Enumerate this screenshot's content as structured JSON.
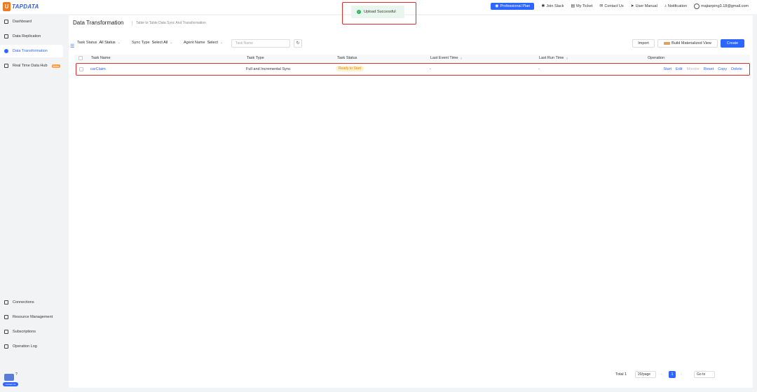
{
  "app": {
    "logo_letter": "U",
    "logo_text": "TAPDATA"
  },
  "topnav": {
    "pro_plan": "Professional Plan",
    "join_slack": "Join Slack",
    "my_ticket": "My Ticket",
    "contact_us": "Contact Us",
    "user_manual": "User Manual",
    "notification": "Notification",
    "user_email": "majianping3.18@gmail.com"
  },
  "sidebar": {
    "items": [
      {
        "label": "Dashboard",
        "icon": "dashboard-icon"
      },
      {
        "label": "Data Replication",
        "icon": "database-icon"
      },
      {
        "label": "Data Transformation",
        "icon": "transformation-icon",
        "active": true
      },
      {
        "label": "Real Time Data Hub",
        "icon": "datahub-icon",
        "badge": "Beta"
      }
    ],
    "bottom_items": [
      {
        "label": "Connections",
        "icon": "connections-icon"
      },
      {
        "label": "Resource Management",
        "icon": "resource-icon"
      },
      {
        "label": "Subscriptions",
        "icon": "subscriptions-icon"
      },
      {
        "label": "Operation Log",
        "icon": "log-icon"
      }
    ],
    "chat_label": "Contact Us",
    "chat_q": "?"
  },
  "page": {
    "title": "Data Transformation",
    "subtitle": "Table to Table Data Sync And Transformation"
  },
  "filters": {
    "task_status_label": "Task Status",
    "task_status_value": "All Status",
    "sync_type_label": "Sync Type",
    "sync_type_value": "Select All",
    "agent_name_label": "Agent Name",
    "agent_name_value": "Select",
    "search_placeholder": "Task Name"
  },
  "actions": {
    "import": "Import",
    "build_mv": "Build Materialized View",
    "create": "Create"
  },
  "table": {
    "headers": [
      "Task Name",
      "Task Type",
      "Task Status",
      "Last Event Time",
      "Last Run Time",
      "Operation"
    ],
    "rows": [
      {
        "task_name": "carClaim",
        "task_type": "Full and Incremental Sync",
        "task_status": "Ready to Start",
        "last_event_time": "-",
        "last_run_time": "-",
        "operations": [
          "Start",
          "Edit",
          "Monitor",
          "Reset",
          "Copy",
          "Delete"
        ]
      }
    ]
  },
  "pagination": {
    "total": "Total 1",
    "page_size": "20/page",
    "current_page": "1",
    "goto": "Go to"
  },
  "toast": {
    "message": "Upload Successful"
  },
  "colors": {
    "accent": "#2c65ff",
    "highlight": "#e42b2b",
    "success": "#2bb55a",
    "badge_bg": "#fff1cc"
  }
}
